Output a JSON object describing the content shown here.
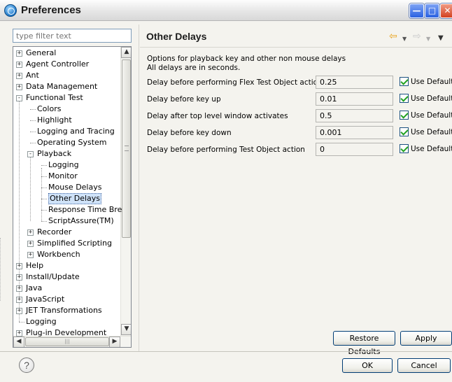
{
  "window": {
    "title": "Preferences"
  },
  "filter": {
    "placeholder": "type filter text"
  },
  "tree": [
    {
      "label": "General",
      "level": 0,
      "toggle": "+"
    },
    {
      "label": "Agent Controller",
      "level": 0,
      "toggle": "+"
    },
    {
      "label": "Ant",
      "level": 0,
      "toggle": "+"
    },
    {
      "label": "Data Management",
      "level": 0,
      "toggle": "+"
    },
    {
      "label": "Functional Test",
      "level": 0,
      "toggle": "-"
    },
    {
      "label": "Colors",
      "level": 1,
      "toggle": ""
    },
    {
      "label": "Highlight",
      "level": 1,
      "toggle": ""
    },
    {
      "label": "Logging and Tracing",
      "level": 1,
      "toggle": ""
    },
    {
      "label": "Operating System",
      "level": 1,
      "toggle": ""
    },
    {
      "label": "Playback",
      "level": 1,
      "toggle": "-"
    },
    {
      "label": "Logging",
      "level": 2,
      "toggle": ""
    },
    {
      "label": "Monitor",
      "level": 2,
      "toggle": ""
    },
    {
      "label": "Mouse Delays",
      "level": 2,
      "toggle": ""
    },
    {
      "label": "Other Delays",
      "level": 2,
      "toggle": "",
      "selected": true
    },
    {
      "label": "Response Time Bre",
      "level": 2,
      "toggle": ""
    },
    {
      "label": "ScriptAssure(TM)",
      "level": 2,
      "toggle": ""
    },
    {
      "label": "Recorder",
      "level": 1,
      "toggle": "+"
    },
    {
      "label": "Simplified Scripting",
      "level": 1,
      "toggle": "+"
    },
    {
      "label": "Workbench",
      "level": 1,
      "toggle": "+"
    },
    {
      "label": "Help",
      "level": 0,
      "toggle": "+"
    },
    {
      "label": "Install/Update",
      "level": 0,
      "toggle": "+"
    },
    {
      "label": "Java",
      "level": 0,
      "toggle": "+"
    },
    {
      "label": "JavaScript",
      "level": 0,
      "toggle": "+"
    },
    {
      "label": "JET Transformations",
      "level": 0,
      "toggle": "+"
    },
    {
      "label": "Logging",
      "level": 0,
      "toggle": ""
    },
    {
      "label": "Plug-in Development",
      "level": 0,
      "toggle": "+"
    }
  ],
  "page": {
    "title": "Other Delays",
    "description_line1": "Options for playback key and other non mouse delays",
    "description_line2": "All delays are in seconds.",
    "rows": [
      {
        "label": "Delay before performing Flex Test Object action",
        "value": "0.25",
        "default_label": "Use Default"
      },
      {
        "label": "Delay before key up",
        "value": "0.01",
        "default_label": "Use Default"
      },
      {
        "label": "Delay after top level window activates",
        "value": "0.5",
        "default_label": "Use Default"
      },
      {
        "label": "Delay before key down",
        "value": "0.001",
        "default_label": "Use Default"
      },
      {
        "label": "Delay before performing Test Object action",
        "value": "0",
        "default_label": "Use Default"
      }
    ]
  },
  "buttons": {
    "restore_defaults": "Restore Defaults",
    "apply": "Apply",
    "ok": "OK",
    "cancel": "Cancel",
    "help": "?"
  },
  "colors": {
    "selection": "#cfe2f8",
    "dialog_background": "#f4f3ee",
    "titlebar_close": "#d3401f",
    "titlebar_buttons": "#2a61e1",
    "back_arrow": "#e8a21a"
  },
  "icons": [
    "app-icon",
    "minimize-icon",
    "maximize-icon",
    "close-icon",
    "back-arrow-icon",
    "forward-arrow-icon",
    "view-menu-icon",
    "help-icon"
  ]
}
